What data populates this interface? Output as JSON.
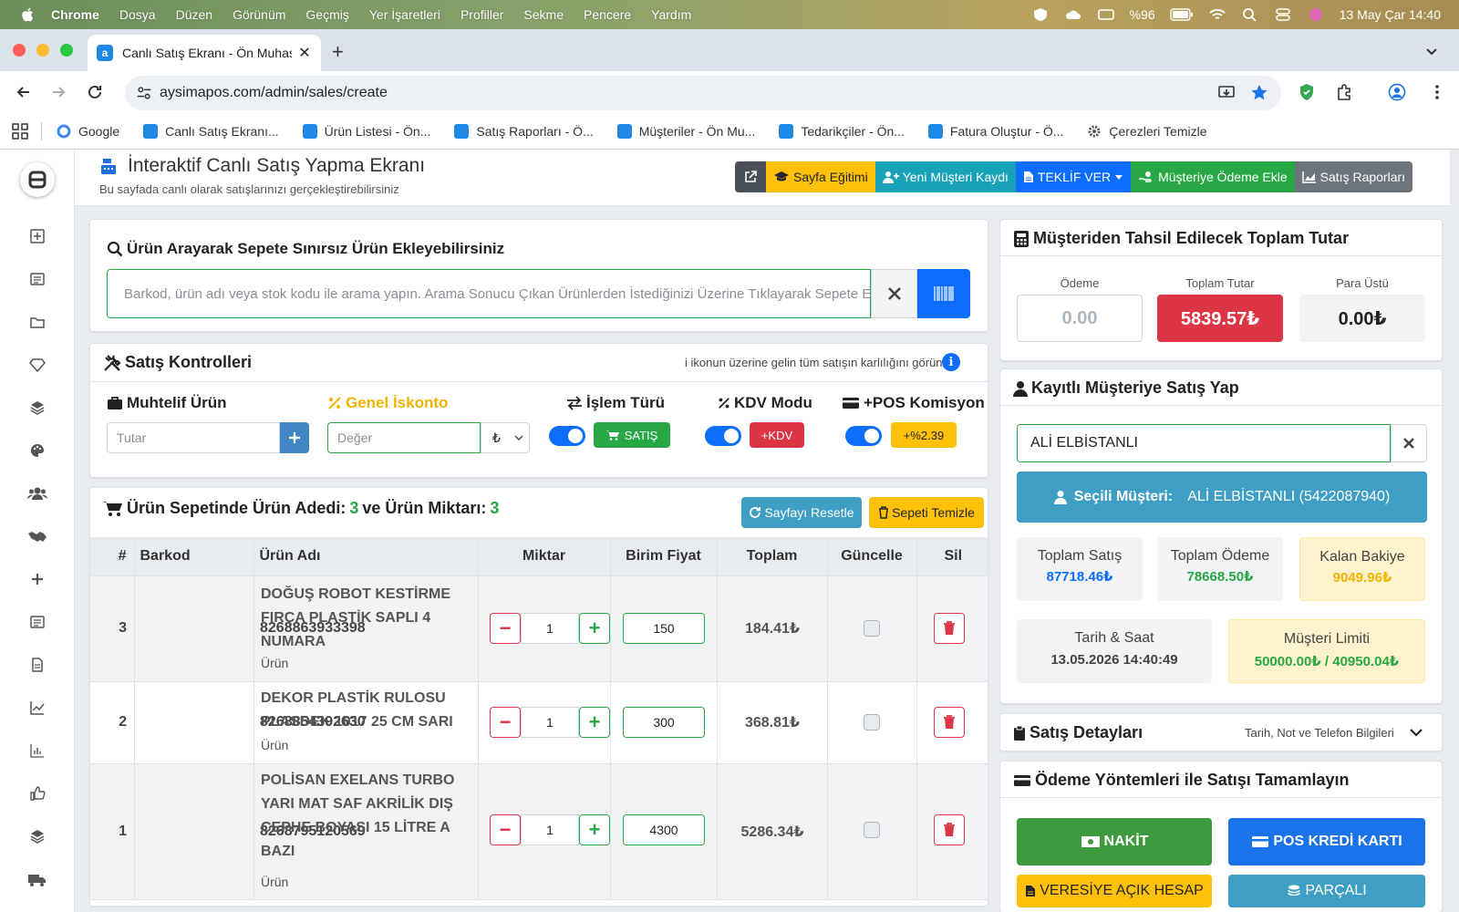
{
  "menubar": {
    "app": "Chrome",
    "items": [
      "Dosya",
      "Düzen",
      "Görünüm",
      "Geçmiş",
      "Yer İşaretleri",
      "Profiller",
      "Sekme",
      "Pencere",
      "Yardım"
    ],
    "battery": "%96",
    "datetime": "13 May Çar  14:40"
  },
  "browser": {
    "tab_title": "Canlı Satış Ekranı - Ön Muhas",
    "url": "aysimapos.com/admin/sales/create",
    "bookmarks": [
      "Google",
      "Canlı Satış Ekranı...",
      "Ürün Listesi - Ön...",
      "Satış Raporları - Ö...",
      "Müşteriler - Ön Mu...",
      "Tedarikçiler - Ön...",
      "Fatura Oluştur - Ö...",
      "Çerezleri Temizle"
    ]
  },
  "header": {
    "title": "İnteraktif Canlı Satış Yapma Ekranı",
    "subtitle": "Bu sayfada canlı olarak satışlarınızı gerçekleştirebilirsiniz",
    "buttons": {
      "training": "Sayfa Eğitimi",
      "new_customer": "Yeni Müşteri Kaydı",
      "offer": "TEKLİF VER",
      "add_payment": "Müşteriye Ödeme Ekle",
      "reports": "Satış Raporları"
    }
  },
  "search": {
    "title": "Ürün Arayarak Sepete Sınırsız Ürün Ekleyebilirsiniz",
    "placeholder": "Barkod, ürün adı veya stok kodu ile arama yapın. Arama Sonucu Çıkan Ürünlerden İstediğinizi Üzerine Tıklayarak Sepete E"
  },
  "controls": {
    "title": "Satış Kontrolleri",
    "hint": "i ikonun üzerine gelin tüm satışın karlılığını görün",
    "misc_label": "Muhtelif Ürün",
    "misc_placeholder": "Tutar",
    "discount_label": "Genel İskonto",
    "discount_placeholder": "Değer",
    "discount_unit": "₺",
    "type_label": "İşlem Türü",
    "type_value": "SATIŞ",
    "kdv_label": "KDV Modu",
    "kdv_value": "+KDV",
    "pos_label": "+POS Komisyon",
    "pos_value": "+%2.39"
  },
  "cart": {
    "title_prefix": "Ürün Sepetinde Ürün Adedi:",
    "count": "3",
    "title_mid": "ve Ürün Miktarı:",
    "quantity": "3",
    "reset_btn": "Sayfayı Resetle",
    "clear_btn": "Sepeti Temizle",
    "columns": [
      "#",
      "Barkod",
      "Ürün Adı",
      "Miktar",
      "Birim Fiyat",
      "Toplam",
      "Güncelle",
      "Sil"
    ],
    "rows": [
      {
        "no": "3",
        "barcode": "8268863933398",
        "name": "DOĞUŞ ROBOT KESTİRME FIRÇA PLASTİK SAPLI 4 NUMARA",
        "type": "Ürün",
        "qty": "1",
        "price": "150",
        "total": "184.41₺"
      },
      {
        "no": "2",
        "barcode": "8268854392630",
        "name": "DEKOR PLASTİK RULOSU PLASDEK 1017 25 CM SARI",
        "type": "Ürün",
        "qty": "1",
        "price": "300",
        "total": "368.81₺"
      },
      {
        "no": "1",
        "barcode": "8268795120569",
        "name": "POLİSAN EXELANS TURBO YARI MAT SAF AKRİLİK DIŞ CEPHE BOYASI 15 LİTRE A BAZI",
        "type": "Ürün",
        "qty": "1",
        "price": "4300",
        "total": "5286.34₺"
      }
    ]
  },
  "totals": {
    "title": "Müşteriden Tahsil Edilecek Toplam Tutar",
    "payment_label": "Ödeme",
    "payment_placeholder": "0.00",
    "total_label": "Toplam Tutar",
    "total_value": "5839.57₺",
    "change_label": "Para Üstü",
    "change_value": "0.00₺"
  },
  "customer": {
    "title": "Kayıtlı Müşteriye Satış Yap",
    "input_value": "ALİ ELBİSTANLI",
    "selected_label": "Seçili Müşteri:",
    "selected_value": "ALİ ELBİSTANLI (5422087940)",
    "total_sales_label": "Toplam Satış",
    "total_sales_value": "87718.46₺",
    "total_payment_label": "Toplam Ödeme",
    "total_payment_value": "78668.50₺",
    "balance_label": "Kalan Bakiye",
    "balance_value": "9049.96₺",
    "datetime_label": "Tarih & Saat",
    "datetime_value": "13.05.2026 14:40:49",
    "limit_label": "Müşteri Limiti",
    "limit_value": "50000.00₺ / 40950.04₺"
  },
  "details": {
    "title": "Satış Detayları",
    "hint": "Tarih, Not ve Telefon Bilgileri"
  },
  "payment": {
    "title": "Ödeme Yöntemleri ile Satışı Tamamlayın",
    "cash": "NAKİT",
    "card": "POS KREDİ KARTI",
    "credit": "VERESİYE AÇIK HESAP",
    "split": "PARÇALI"
  },
  "colors": {
    "primary": "#0d6efd",
    "success": "#28a745",
    "danger": "#dc3545",
    "warning": "#ffc107",
    "info": "#17a2b8",
    "secondary": "#6c757d"
  }
}
